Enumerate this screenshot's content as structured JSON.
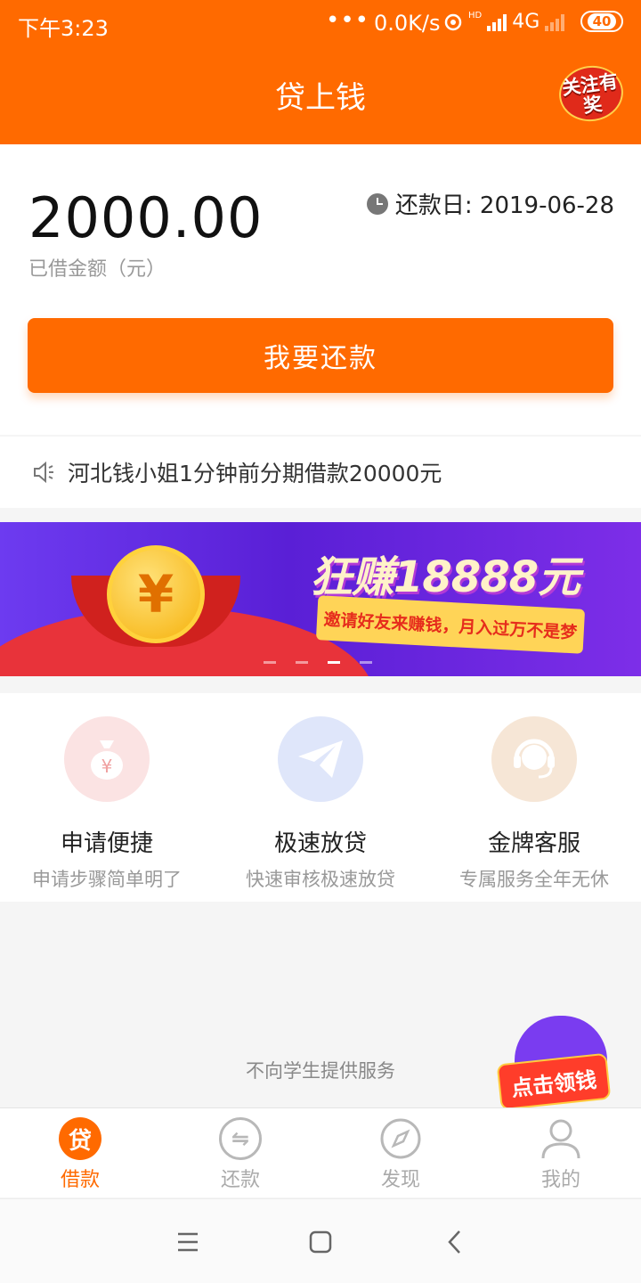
{
  "status_bar": {
    "time": "下午3:23",
    "dots": "•••",
    "speed": "0.0K/s",
    "hd": "HD",
    "network": "4G",
    "battery": "40"
  },
  "header": {
    "title": "贷上钱",
    "badge_text": "关注有奖"
  },
  "loan": {
    "amount": "2000.00",
    "amount_label": "已借金额（元）",
    "due_label": "还款日: 2019-06-28",
    "repay_button": "我要还款"
  },
  "notice": {
    "text": "河北钱小姐1分钟前分期借款20000元"
  },
  "banner": {
    "coin_symbol": "¥",
    "headline": "狂赚18888元",
    "ribbon": "邀请好友来赚钱，月入过万不是梦",
    "slide_count": 4,
    "active_slide": 3
  },
  "features": [
    {
      "title": "申请便捷",
      "subtitle": "申请步骤简单明了",
      "icon": "money-bag-icon",
      "bg": "#fbe3e3",
      "color": "#f0a0a0"
    },
    {
      "title": "极速放贷",
      "subtitle": "快速审核极速放贷",
      "icon": "paper-plane-icon",
      "bg": "#dfe6fa",
      "color": "#a6b8ee"
    },
    {
      "title": "金牌客服",
      "subtitle": "专属服务全年无休",
      "icon": "headset-agent-icon",
      "bg": "#f6e6d6",
      "color": "#e6c7a8"
    }
  ],
  "footer_note": "不向学生提供服务",
  "promo_float": {
    "label": "点击领钱"
  },
  "tabs": [
    {
      "label": "借款",
      "icon": "loan-icon",
      "icon_glyph": "贷",
      "active": true
    },
    {
      "label": "还款",
      "icon": "repay-icon",
      "icon_glyph": "⇋",
      "active": false
    },
    {
      "label": "发现",
      "icon": "compass-icon",
      "icon_glyph": "",
      "active": false
    },
    {
      "label": "我的",
      "icon": "user-icon",
      "icon_glyph": "",
      "active": false
    }
  ],
  "colors": {
    "brand": "#ff6a00",
    "tab_inactive": "#aaaaaa"
  }
}
